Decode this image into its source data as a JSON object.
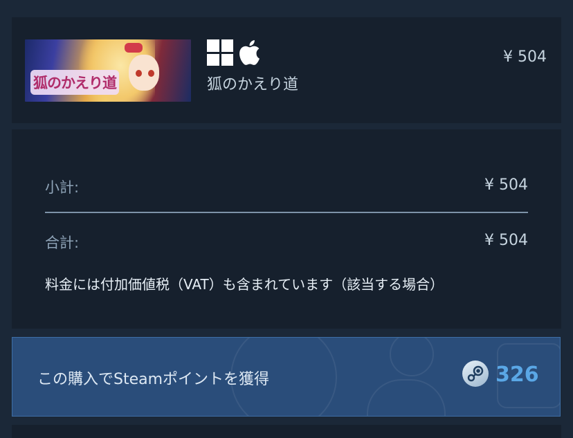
{
  "cart_item": {
    "capsule_logo_text": "狐のかえり道",
    "title": "狐のかえり道",
    "price": "¥ 504",
    "platform_icons": [
      "windows-icon",
      "apple-icon"
    ]
  },
  "summary": {
    "subtotal_label": "小計:",
    "subtotal_value": "¥ 504",
    "total_label": "合計:",
    "total_value": "¥ 504",
    "vat_note": "料金には付加価値税（VAT）も含まれています（該当する場合）"
  },
  "points": {
    "label": "この購入でSteamポイントを獲得",
    "value": "326",
    "icon": "steam-points-icon"
  },
  "colors": {
    "page_bg": "#1b2838",
    "panel_bg": "#16202d",
    "points_bg": "#2a4d7a",
    "points_value": "#5aa7e6"
  }
}
